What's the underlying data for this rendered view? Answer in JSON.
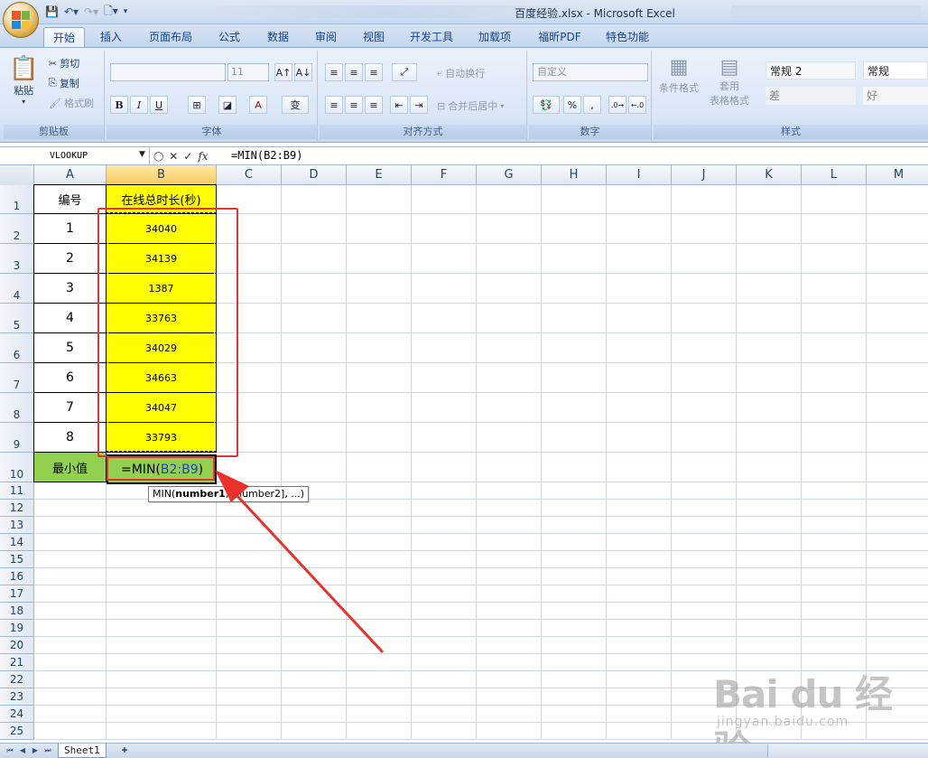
{
  "window": {
    "title": "百度经验.xlsx - Microsoft Excel"
  },
  "ribbon": {
    "tabs": [
      "开始",
      "插入",
      "页面布局",
      "公式",
      "数据",
      "审阅",
      "视图",
      "开发工具",
      "加载项",
      "福昕PDF",
      "特色功能"
    ],
    "clipboard": {
      "paste": "粘贴",
      "cut": "剪切",
      "copy": "复制",
      "format_painter": "格式刷",
      "label": "剪贴板"
    },
    "font": {
      "size": "11",
      "label": "字体",
      "bold": "B",
      "italic": "I",
      "underline": "U"
    },
    "alignment": {
      "wrap": "自动换行",
      "merge": "合并后居中",
      "label": "对齐方式"
    },
    "number": {
      "format": "自定义",
      "percent": "%",
      "comma": ",",
      "label": "数字"
    },
    "styles": {
      "conditional": "条件格式",
      "table_line1": "套用",
      "table_line2": "表格格式",
      "normal2": "常规 2",
      "normal": "常规",
      "bad": "差",
      "good": "好",
      "label": "样式"
    }
  },
  "formula_bar": {
    "name_box": "VLOOKUP",
    "formula": "=MIN(B2:B9)",
    "fx": "fx"
  },
  "columns": [
    "A",
    "B",
    "C",
    "D",
    "E",
    "F",
    "G",
    "H",
    "I",
    "J",
    "K",
    "L",
    "M"
  ],
  "rows": [
    "1",
    "2",
    "3",
    "4",
    "5",
    "6",
    "7",
    "8",
    "9",
    "10",
    "11",
    "12",
    "13",
    "14",
    "15",
    "16",
    "17",
    "18",
    "19",
    "20",
    "21",
    "22",
    "23",
    "24",
    "25"
  ],
  "table": {
    "header_a": "编号",
    "header_b": "在线总时长(秒)",
    "ids": [
      "1",
      "2",
      "3",
      "4",
      "5",
      "6",
      "7",
      "8"
    ],
    "values": [
      "34040",
      "34139",
      "1387",
      "33763",
      "34029",
      "34663",
      "34047",
      "33793"
    ],
    "min_label": "最小值",
    "edit_prefix": "=MIN(",
    "edit_ref": "B2:B9",
    "edit_suffix": ")"
  },
  "tooltip": {
    "func": "MIN(",
    "arg1": "number1",
    "rest": ", [number2], ...)"
  },
  "sheet_tab": "Sheet1",
  "watermark": {
    "brand": "Bai du 经验",
    "url": "jingyan.baidu.com"
  },
  "colors": {
    "yellow": "#ffff00",
    "green": "#92d050",
    "red": "#e8322b",
    "accent": "#15428b"
  }
}
